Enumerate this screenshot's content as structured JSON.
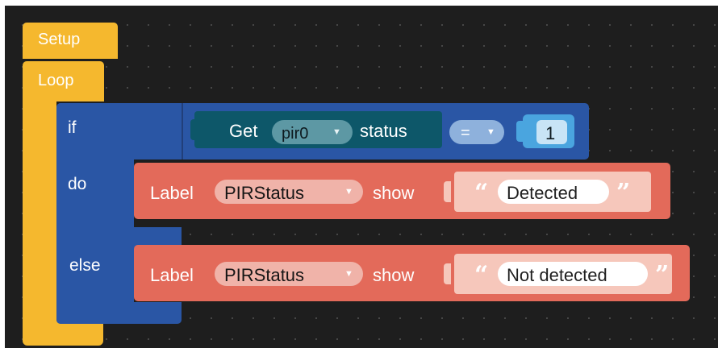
{
  "setup_block": {
    "label": "Setup"
  },
  "loop_block": {
    "label": "Loop"
  },
  "if_block": {
    "if_label": "if",
    "do_label": "do",
    "else_label": "else"
  },
  "condition": {
    "get_label": "Get",
    "sensor_value": "pir0",
    "status_label": "status",
    "operator": "=",
    "compare_value": "1"
  },
  "label_block_1": {
    "label": "Label",
    "target": "PIRStatus",
    "show_label": "show",
    "text": "Detected",
    "quote_open": "“",
    "quote_close": "”"
  },
  "label_block_2": {
    "label": "Label",
    "target": "PIRStatus",
    "show_label": "show",
    "text": "Not detected",
    "quote_open": "“",
    "quote_close": "”"
  },
  "colors": {
    "workspace": "#1e1e1e",
    "setup_loop": "#f5b82e",
    "logic": "#2a56a5",
    "sensor": "#0d5769",
    "math": "#4aa5df",
    "label": "#e36a5a",
    "string": "#f6c7bb"
  },
  "icons": {
    "dropdown": "triangle-down"
  }
}
